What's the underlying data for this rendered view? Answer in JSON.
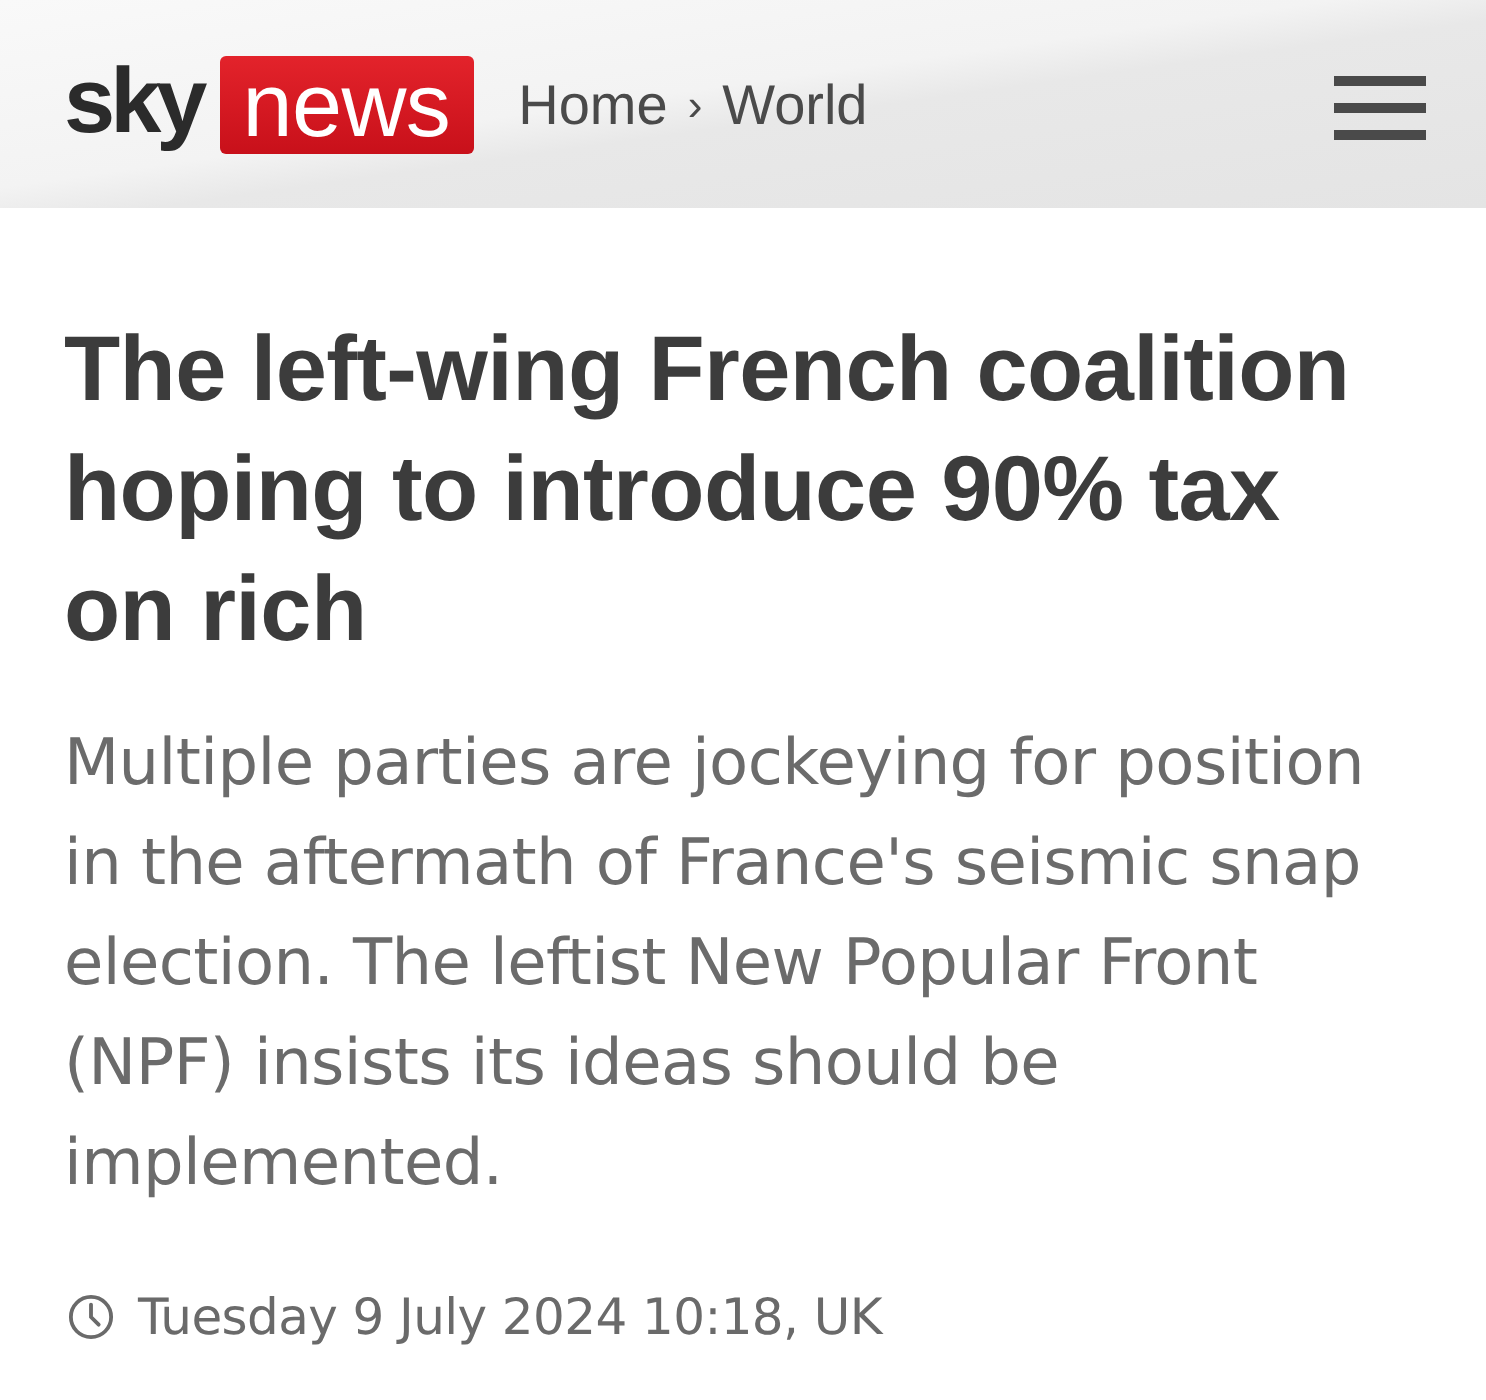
{
  "header": {
    "logo": {
      "sky": "sky",
      "news": "news"
    },
    "breadcrumb": {
      "items": [
        "Home",
        "World"
      ],
      "separator": "›"
    }
  },
  "article": {
    "headline": "The left-wing French coalition hoping to introduce 90% tax on rich",
    "standfirst": "Multiple parties are jockeying for position in the aftermath of France's seismic snap election. The leftist New Popular Front (NPF) insists its ideas should be implemented.",
    "timestamp": "Tuesday 9 July 2024 10:18, UK"
  }
}
